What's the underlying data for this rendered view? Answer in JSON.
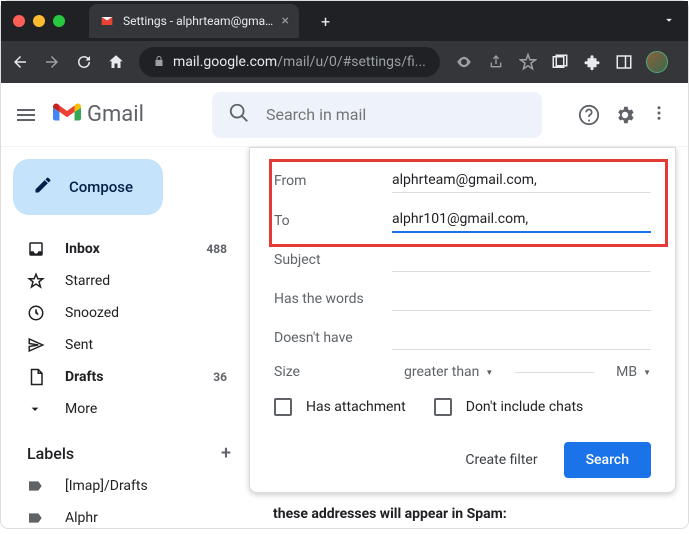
{
  "browser": {
    "tab_title": "Settings - alphrteam@gmail.co",
    "url_host": "mail.google.com",
    "url_path": "/mail/u/0/#settings/fi..."
  },
  "header": {
    "product": "Gmail",
    "search_placeholder": "Search in mail"
  },
  "sidebar": {
    "compose": "Compose",
    "items": [
      {
        "icon": "inbox",
        "label": "Inbox",
        "count": "488",
        "bold": true
      },
      {
        "icon": "star",
        "label": "Starred",
        "count": "",
        "bold": false
      },
      {
        "icon": "clock",
        "label": "Snoozed",
        "count": "",
        "bold": false
      },
      {
        "icon": "send",
        "label": "Sent",
        "count": "",
        "bold": false
      },
      {
        "icon": "file",
        "label": "Drafts",
        "count": "36",
        "bold": true
      },
      {
        "icon": "chev",
        "label": "More",
        "count": "",
        "bold": false
      }
    ],
    "labels_header": "Labels",
    "labels": [
      {
        "label": "[Imap]/Drafts"
      },
      {
        "label": "Alphr"
      }
    ]
  },
  "filter": {
    "from_label": "From",
    "from_value": "alphrteam@gmail.com,",
    "to_label": "To",
    "to_value": "alphr101@gmail.com,",
    "subject_label": "Subject",
    "subject_value": "",
    "haswords_label": "Has the words",
    "haswords_value": "",
    "doesnt_label": "Doesn't have",
    "doesnt_value": "",
    "size_label": "Size",
    "size_op": "greater than",
    "size_unit": "MB",
    "has_attachment": "Has attachment",
    "dont_include": "Don't include chats",
    "create_filter": "Create filter",
    "search": "Search"
  },
  "background_hint": "these addresses will appear in Spam:"
}
